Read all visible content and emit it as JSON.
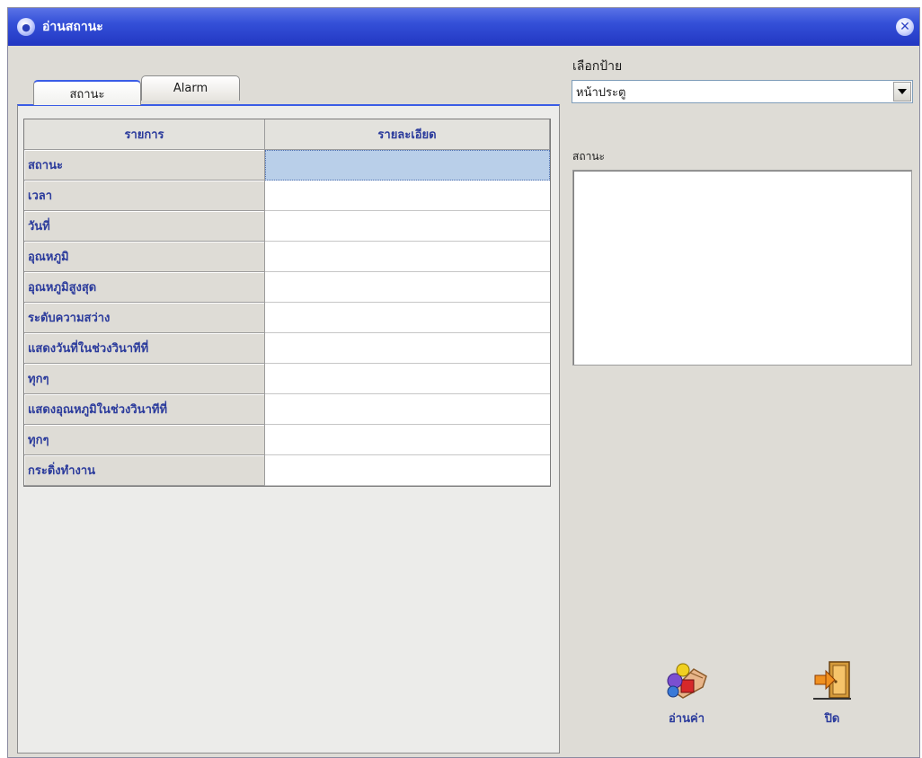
{
  "window": {
    "title": "อ่านสถานะ",
    "close_glyph": "✕"
  },
  "tabs": [
    {
      "label": "สถานะ",
      "active": true
    },
    {
      "label": "Alarm",
      "active": false
    }
  ],
  "grid": {
    "headers": [
      "รายการ",
      "รายละเอียด"
    ],
    "rows": [
      {
        "label": "สถานะ",
        "value": ""
      },
      {
        "label": "เวลา",
        "value": ""
      },
      {
        "label": "วันที่",
        "value": ""
      },
      {
        "label": "อุณหภูมิ",
        "value": ""
      },
      {
        "label": "อุณหภูมิสูงสุด",
        "value": ""
      },
      {
        "label": "ระดับความสว่าง",
        "value": ""
      },
      {
        "label": "แสดงวันที่ในช่วงวินาทีที่",
        "value": ""
      },
      {
        "label": "ทุกๆ",
        "value": ""
      },
      {
        "label": "แสดงอุณหภูมิในช่วงวินาทีที่",
        "value": ""
      },
      {
        "label": "ทุกๆ",
        "value": ""
      },
      {
        "label": "กระดิ่งทำงาน",
        "value": ""
      }
    ]
  },
  "right": {
    "select_label": "เลือกป้าย",
    "select_value": "หน้าประตู",
    "status_label": "สถานะ",
    "status_text": ""
  },
  "actions": {
    "read_label": "อ่านค่า",
    "close_label": "ปิด"
  },
  "icons": {
    "title": "app-icon",
    "close": "close-icon",
    "dropdown": "chevron-down-icon",
    "read": "read-values-icon",
    "exit": "exit-door-icon"
  }
}
